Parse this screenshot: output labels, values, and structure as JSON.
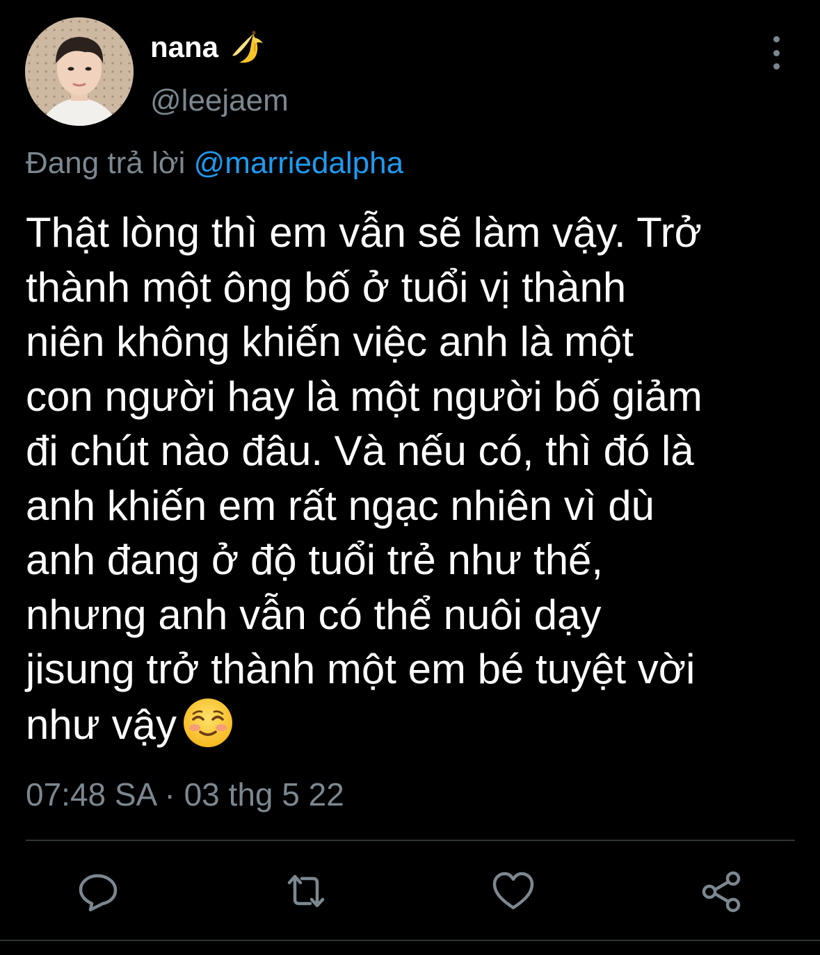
{
  "author": {
    "display_name": "nana",
    "name_emoji": "banana-emoji",
    "handle": "@leejaem"
  },
  "reply_context": {
    "prefix": "Đang trả lời",
    "mention": "@marriedalpha"
  },
  "tweet": {
    "lines": [
      "Thật lòng thì em vẫn sẽ làm vậy. Trở",
      "thành một ông bố ở tuổi vị thành",
      "niên không khiến việc anh là một",
      "con người hay là một người bố giảm",
      "đi chút nào đâu. Và nếu có, thì đó là",
      "anh khiến em rất ngạc nhiên vì dù",
      "anh đang ở độ tuổi trẻ như thế,",
      "nhưng anh vẫn có thể nuôi dạy",
      "jisung trở thành một em bé tuyệt vời",
      "như vậy"
    ],
    "trailing_emoji": "smiling-face-with-smiling-eyes-emoji",
    "timestamp": "07:48 SA · 03 thg 5 22"
  },
  "actions": [
    {
      "name": "reply",
      "icon": "speech-bubble-icon"
    },
    {
      "name": "retweet",
      "icon": "retweet-icon"
    },
    {
      "name": "like",
      "icon": "heart-icon"
    },
    {
      "name": "share",
      "icon": "share-icon"
    }
  ],
  "colors": {
    "background": "#000000",
    "primary_text": "#ffffff",
    "secondary_text": "#7c8790",
    "mention": "#1d9bf0",
    "divider": "#2f3336"
  }
}
